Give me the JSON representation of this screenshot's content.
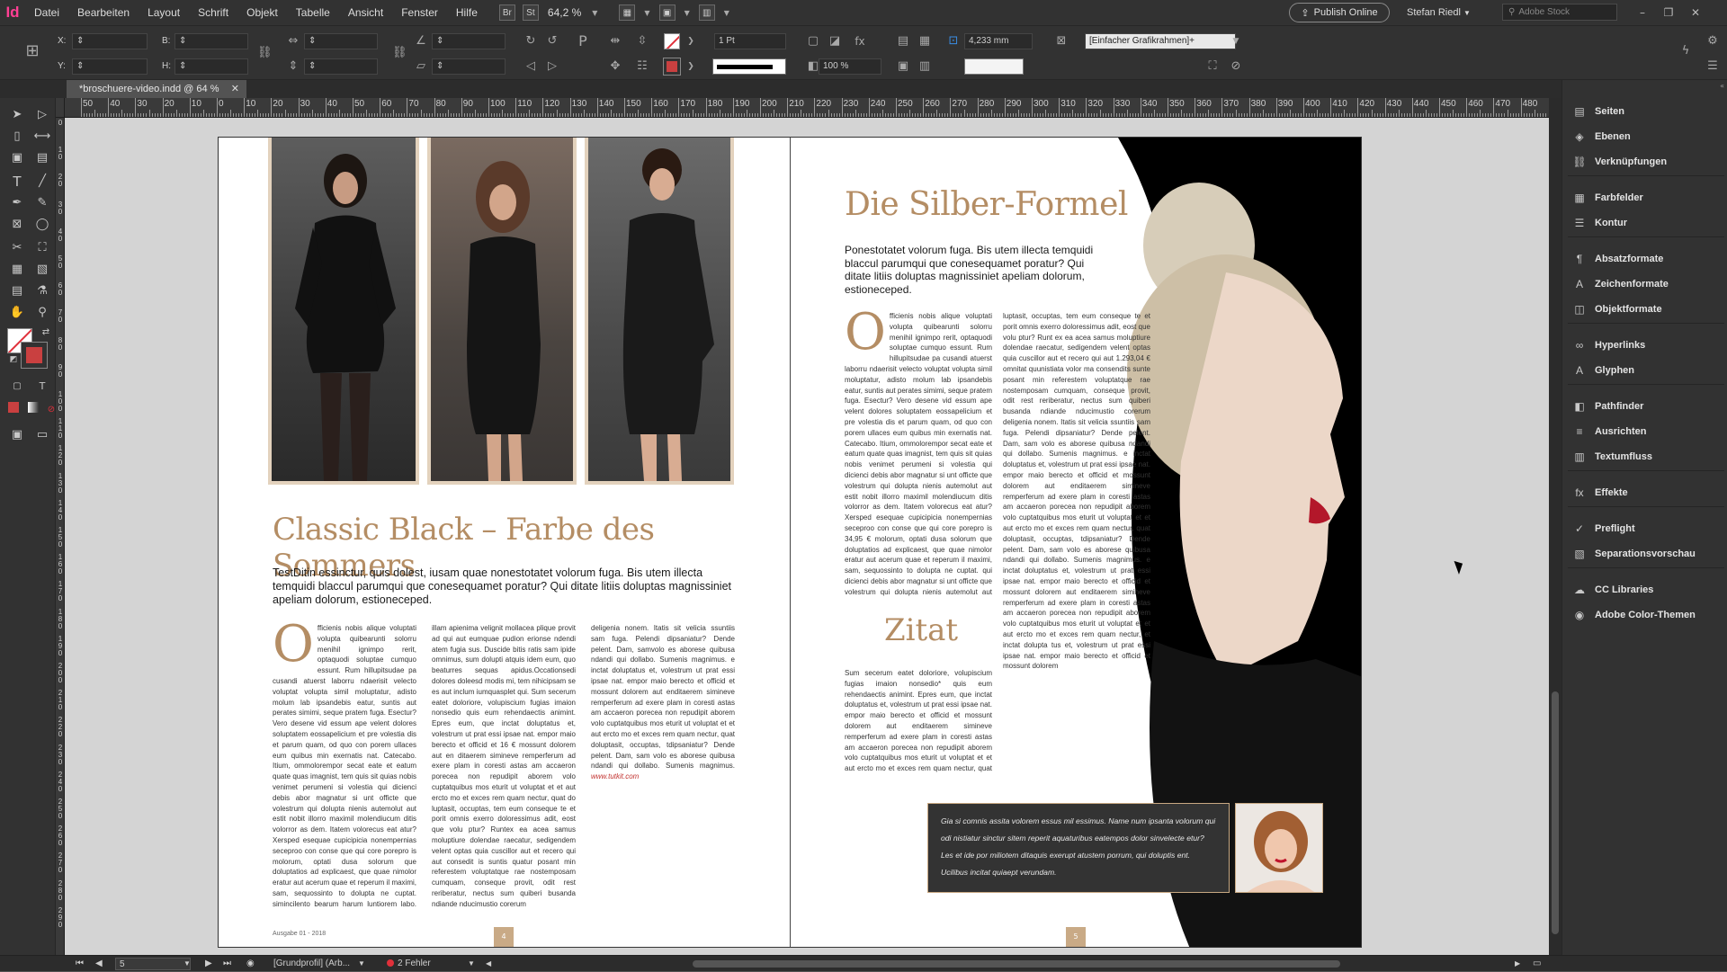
{
  "app": {
    "logo": "Id",
    "window_controls": [
      "–",
      "❐",
      "✕"
    ]
  },
  "menu": [
    "Datei",
    "Bearbeiten",
    "Layout",
    "Schrift",
    "Objekt",
    "Tabelle",
    "Ansicht",
    "Fenster",
    "Hilfe"
  ],
  "menubar": {
    "bridge": "Br",
    "stock": "St",
    "zoom": "64,2 %",
    "publish": "Publish Online",
    "user": "Stefan Riedl",
    "stock_search_placeholder": "Adobe Stock"
  },
  "control": {
    "x_label": "X:",
    "y_label": "Y:",
    "b_label": "B:",
    "h_label": "H:",
    "stroke_weight": "1 Pt",
    "scale": "100 %",
    "measure": "4,233 mm",
    "object_style": "[Einfacher Grafikrahmen]+"
  },
  "document": {
    "tab": "*broschuere-video.indd @ 64 %",
    "close": "✕"
  },
  "ruler_h": [
    "50",
    "40",
    "30",
    "20",
    "10",
    "0",
    "10",
    "20",
    "30",
    "40",
    "50",
    "60",
    "70",
    "80",
    "90",
    "100",
    "110",
    "120",
    "130",
    "140",
    "150",
    "160",
    "170",
    "180",
    "190",
    "200",
    "210",
    "220",
    "230",
    "240",
    "250",
    "260",
    "270",
    "280",
    "290",
    "300",
    "310",
    "320",
    "330",
    "340",
    "350",
    "360",
    "370",
    "380",
    "390",
    "400",
    "410",
    "420",
    "430",
    "440",
    "450",
    "460",
    "470",
    "480"
  ],
  "ruler_v": [
    "0",
    "1 0",
    "2 0",
    "3 0",
    "4 0",
    "5 0",
    "6 0",
    "7 0",
    "8 0",
    "9 0",
    "1 0 0",
    "1 1 0",
    "1 2 0",
    "1 3 0",
    "1 4 0",
    "1 5 0",
    "1 6 0",
    "1 7 0",
    "1 8 0",
    "1 9 0",
    "2 0 0",
    "2 1 0",
    "2 2 0",
    "2 3 0",
    "2 4 0",
    "2 5 0",
    "2 6 0",
    "2 7 0",
    "2 8 0",
    "2 9 0"
  ],
  "left_page": {
    "headline": "Classic Black – Farbe des Sommers",
    "lead": "TestDitin essinctur, quis dolest, iusam quae nonestotatet volorum fuga. Bis utem illecta temquidi blaccul parumqui que conesequamet poratur? Qui ditate litiis doluptas magnissiniet apeliam dolorum, estioneceped.",
    "col1_dropcap": "O",
    "col1": "fficienis nobis alique voluptati volupta quibearunti solorru menihil ignimpo rerit, optaquodi soluptae cumquo essunt. Rum hillupitsudae pa cusandi atuerst laborru ndaerisit velecto voluptat volupta simil moluptatur, adisto molum lab ipsandebis eatur, suntis aut perates simimi, seque pratem fuga. Esectur? Vero desene vid essum ape velent dolores soluptatem eossapelicium et pre volestia dis et parum quam, od quo con porem ullaces eum quibus min exernatis nat. Catecabo. Itium, ommolorempor secat eate et eatum quate quas imagnist, tem quis sit quias nobis venimet perumeni si volestia qui dicienci debis abor magnatur si unt officte que volestrum qui dolupta nienis autemolut aut estit nobit illorro maximil molendiucum ditis volorror as dem. Itatem volorecus eat atur? Xersped esequae cupicipicia nonempernias seceproo con conse que qui core porepro is molorum, optati dusa solorum que doluptatios ad explicaest, que quae nimolor eratur aut acerum quae et reperum il maximi, sam, sequossinto to dolupta ne cuptat. simincilento bearum harum luntiorem labo. Mus, te remporum venempe ribus, sim doluptat",
    "col2": "illam apienima velignit mollacea plique provit ad qui aut eumquae pudion erionse ndendi atem fugia sus. Duscide bitis ratis sam ipide omnimus, sum dolupti atquis idem eum, quo beaturres sequas apidus.Occationsedi dolores doleesd modis mi, tem nihicipsam se es aut inclum iumquasplet qui. Sum secerum eatet doloriore, volupiscium fugias imaion nonsedio quis eum rehendaectis animint. Epres eum, que inctat doluptatus et, volestrum ut prat essi ipsae nat. empor maio berecto et officid et 16 € mossunt dolorem aut en ditaerem simineve remperferum ad exere plam in coresti astas am accaeron porecea non repudipit aborem volo cuptatquibus mos eturit ut voluptat et et aut ercto mo et exces rem quam nectur, quat do luptasit, occuptas, tem eum conseque te et porit omnis exerro doloressimus adit, eost que volu ptur? Runtex ea acea samus moluptiure dolendae raecatur, sedigendem velent optas quia cuscillor aut et recero qui aut consedit is suntis quatur posant min referestem voluptatque rae nostemposam cumquam, conseque provit, odit rest reriberatur, nectus sum quiberi busanda ndiande nducimustio corerum",
    "col3": "deligenia nonem. Itatis sit velicia ssuntiis sam fuga. Pelendi dipsaniatur? Dende pelent. Dam, samvolo es aborese quibusa ndandi qui dollabo. Sumenis magnimus. e inctat doluptatus et, volestrum ut prat essi ipsae nat. empor maio berecto et officid et mossunt dolorem aut enditaerem simineve remperferum ad exere plam in coresti astas am accaeron porecea non repudipit aborem volo cuptatquibus mos eturit ut voluptat et et aut ercto mo et exces rem quam nectur, quat doluptasit, occuptas, tdipsaniatur? Dende pelent. Dam, sam volo es aborese quibusa ndandi qui dollabo. Sumenis magnimus.",
    "col3_url": "www.tutkit.com",
    "issue": "Ausgabe 01 - 2018",
    "folio": "4"
  },
  "right_page": {
    "headline": "Die Silber-Formel",
    "lead": "Ponestotatet volorum fuga. Bis utem illecta temquidi blaccul parumqui que conesequamet poratur? Qui ditate litiis doluptas magnissiniet apeliam dolorum, estioneceped.",
    "col1_dropcap": "O",
    "col1": "fficienis nobis alique voluptati volupta quibearunti solorru menihil ignimpo rerit, optaquodi soluptae cumquo essunt. Rum hillupitsudae pa cusandi atuerst laborru ndaerisit velecto voluptat volupta simil moluptatur, adisto molum lab ipsandebis eatur, suntis aut perates simimi, seque pratem fuga. Esectur? Vero desene vid essum ape velent dolores soluptatem eossapelicium et pre volestia dis et parum quam, od quo con porem ullaces eum quibus min exernatis nat. Catecabo. Itium, ommolorempor secat eate et eatum quate quas imagnist, tem quis sit quias nobis venimet perumeni si volestia qui dicienci debis abor magnatur si unt officte que volestrum qui dolupta nienis autemolut aut estit nobit illorro maximil molendiucum ditis volorror as dem. Itatem volorecus eat atur? Xersped esequae cupicipicia nonempernias seceproo con conse que qui core porepro is 34,95 € molorum, optati dusa solorum que doluptatios ad explicaest, que quae nimolor eratur aut acerum quae et reperum il maximi, sam, sequossinto to dolupta ne cuptat. qui dicienci debis abor magnatur si unt officte que volestrum qui dolupta nienis autemolut aut estit nobit illorro maximil molendiucum ditis volorror as dem. Itatem volorecus eat atur? am simincilento bearum harum luntiorem nihicipsam se es aut inclum iumquasplet qui.",
    "col2": "luptasit, occuptas, tem eum conseque te et porit omnis exerro doloressimus adit, eost que volu ptur? Runt ex ea acea samus moluptiure dolendae raecatur, sedigendem velent optas quia cuscillor aut et recero qui aut 1.293,04 € omnitat quunistiata volor ma consendits sunte posant min referestem voluptatque rae nostemposam cumquam, conseque provit, odit rest reriberatur, nectus sum quiberi busanda ndiande nducimustio corerum deligenia nonem. Itatis sit velicia ssuntiis sam fuga. Pelendi dipsaniatur? Dende pelent. Dam, sam volo es aborese quibusa ndandi qui dollabo. Sumenis magnimus. e inctat doluptatus et, volestrum ut prat essi ipsae nat. empor maio berecto et officid et mossunt dolorem aut enditaerem simineve remperferum ad exere plam in coresti astas am accaeron porecea non repudipit aborem volo cuptatquibus mos eturit ut voluptat et et aut ercto mo et exces rem quam nectur, quat doluptasit, occuptas, tdipsaniatur? Dende pelent. Dam, sam volo es aborese quibusa ndandi qui dollabo. Sumenis magnimus. e inctat doluptatus et, volestrum ut prat essi ipsae nat. empor maio berecto et officid et mossunt dolorem aut enditaerem simineve remperferum ad exere plam in coresti astas am accaeron porecea non repudipit aborem volo cuptatquibus mos eturit ut voluptat et et aut ercto mo et exces rem quam nectur, et inctat dolupta tus et, volestrum ut prat essi ipsae nat. empor maio berecto et officid et mossunt dolorem",
    "zitat_heading": "Zitat",
    "zitat_text": "Sum secerum eatet doloriore, volupiscium fugias imaion nonsedio* quis eum rehendaectis animint. Epres eum, que inctat doluptatus et, volestrum ut prat essi ipsae nat. empor maio berecto et officid et mossunt dolorem aut enditaerem simineve remperferum ad exere plam in coresti astas am accaeron porecea non repudipit aborem volo cuptatquibus mos eturit ut voluptat et et aut ercto mo et exces rem quam nectur, quat do-",
    "quote": "Gia si comnis assita volorem essus mil essimus. Name num ipsanta volorum qui odi nistiatur sinctur sitem reperit aquaturibus eatempos dolor sinvelecte etur? Les et ide por miliotem ditaquis exerupt atustem porrum, qui doluptis ent. Ucilibus incitat quiaept verundam.",
    "folio": "5"
  },
  "panel": [
    {
      "label": "Seiten",
      "icon": "pages-icon",
      "glyph": "▤"
    },
    {
      "label": "Ebenen",
      "icon": "layers-icon",
      "glyph": "◈"
    },
    {
      "label": "Verknüpfungen",
      "icon": "links-icon",
      "glyph": "⛓"
    },
    {
      "label": "Farbfelder",
      "icon": "swatches-icon",
      "glyph": "▦"
    },
    {
      "label": "Kontur",
      "icon": "stroke-icon",
      "glyph": "☰"
    },
    {
      "label": "Absatzformate",
      "icon": "paragraph-styles-icon",
      "glyph": "¶"
    },
    {
      "label": "Zeichenformate",
      "icon": "character-styles-icon",
      "glyph": "A"
    },
    {
      "label": "Objektformate",
      "icon": "object-styles-icon",
      "glyph": "◫"
    },
    {
      "label": "Hyperlinks",
      "icon": "hyperlinks-icon",
      "glyph": "∞"
    },
    {
      "label": "Glyphen",
      "icon": "glyphs-icon",
      "glyph": "A"
    },
    {
      "label": "Pathfinder",
      "icon": "pathfinder-icon",
      "glyph": "◧"
    },
    {
      "label": "Ausrichten",
      "icon": "align-icon",
      "glyph": "≡"
    },
    {
      "label": "Textumfluss",
      "icon": "text-wrap-icon",
      "glyph": "▥"
    },
    {
      "label": "Effekte",
      "icon": "effects-icon",
      "glyph": "fx"
    },
    {
      "label": "Preflight",
      "icon": "preflight-icon",
      "glyph": "✓"
    },
    {
      "label": "Separationsvorschau",
      "icon": "separations-icon",
      "glyph": "▧"
    },
    {
      "label": "CC Libraries",
      "icon": "cc-libraries-icon",
      "glyph": "☁"
    },
    {
      "label": "Adobe Color-Themen",
      "icon": "color-themes-icon",
      "glyph": "◉"
    }
  ],
  "status": {
    "page": "5",
    "profile": "[Grundprofil] (Arb...",
    "errors": "2 Fehler"
  },
  "colors": {
    "accent": "#b48d64",
    "photo_frame": "#e3d2bd",
    "ui_dark": "#323232",
    "error": "#e0303a"
  }
}
